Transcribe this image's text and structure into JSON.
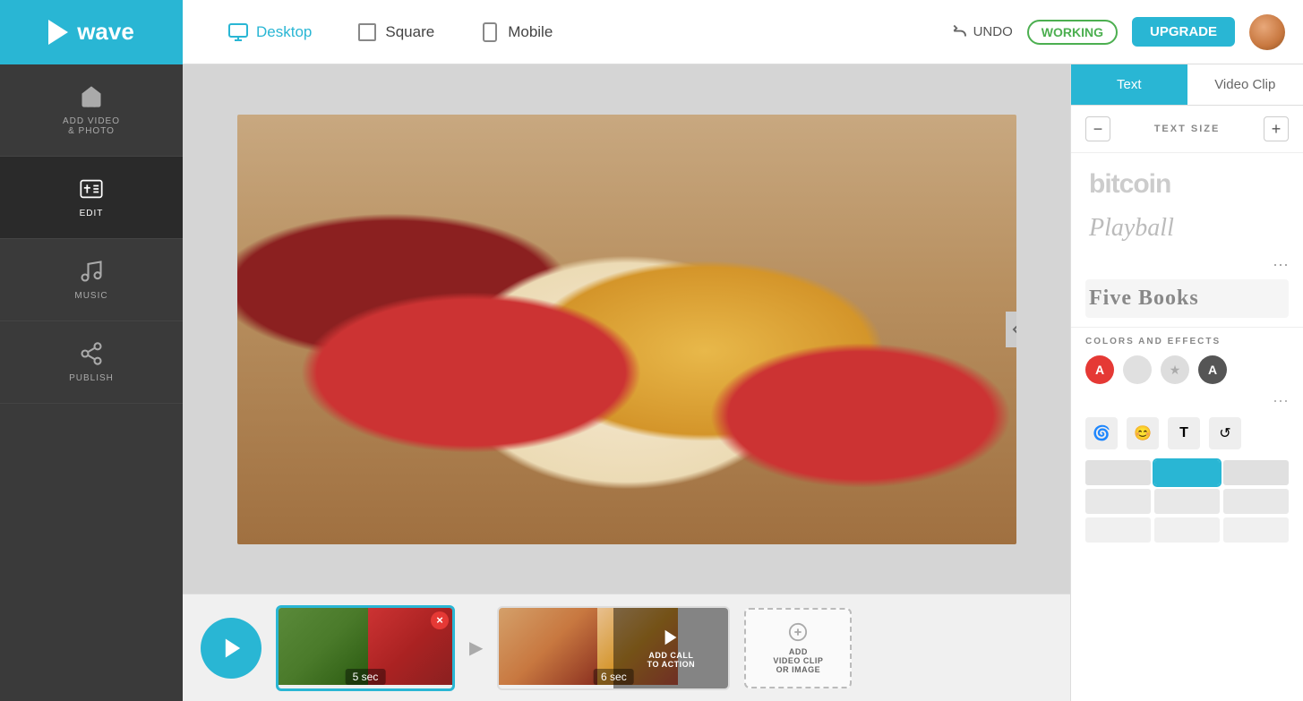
{
  "logo": {
    "text": "wave"
  },
  "topbar": {
    "formats": [
      {
        "id": "desktop",
        "label": "Desktop",
        "active": true
      },
      {
        "id": "square",
        "label": "Square",
        "active": false
      },
      {
        "id": "mobile",
        "label": "Mobile",
        "active": false
      }
    ],
    "undo_label": "UNDO",
    "working_label": "WORKING",
    "upgrade_label": "UPGRADE"
  },
  "sidebar": {
    "items": [
      {
        "id": "add-video",
        "label": "ADD VIDEO\n& PHOTO",
        "active": false
      },
      {
        "id": "edit",
        "label": "EDIT",
        "active": true
      },
      {
        "id": "music",
        "label": "MUSIC",
        "active": false
      },
      {
        "id": "publish",
        "label": "PUBLISH",
        "active": false
      }
    ]
  },
  "right_panel": {
    "tabs": [
      {
        "id": "text",
        "label": "Text",
        "active": true
      },
      {
        "id": "video-clip",
        "label": "Video Clip",
        "active": false
      }
    ],
    "text_size_label": "TEXT SIZE",
    "fonts": [
      {
        "id": "bitcoin",
        "name": "bitcoin",
        "style": "bitcoin"
      },
      {
        "id": "playball",
        "name": "Playball",
        "style": "playball"
      },
      {
        "id": "five-books",
        "name": "Five Books",
        "style": "five-books"
      }
    ],
    "more_label": "...",
    "colors_effects_title": "COLORS AND EFFECTS",
    "color_circles": [
      {
        "id": "red",
        "type": "red"
      },
      {
        "id": "light-gray",
        "type": "light-gray"
      },
      {
        "id": "star",
        "type": "star"
      },
      {
        "id": "dark",
        "type": "dark"
      }
    ],
    "effect_icons": [
      "🌀",
      "😊",
      "T",
      "↺"
    ],
    "swatches": [
      [
        "#e0e0e0",
        "#29b6d4",
        "#e0e0e0"
      ],
      [
        "#e0e0e0",
        "#e0e0e0",
        "#e0e0e0"
      ],
      [
        "#e0e0e0",
        "#e0e0e0",
        "#e0e0e0"
      ]
    ]
  },
  "timeline": {
    "play_label": "Play",
    "clips": [
      {
        "id": "clip1",
        "duration": "5 sec",
        "active": true
      },
      {
        "id": "clip2",
        "duration": "6 sec",
        "active": false
      }
    ],
    "add_call_label": "ADD CALL\nTO ACTION",
    "add_clip_label": "ADD\nVIDEO CLIP\nOR IMAGE"
  }
}
